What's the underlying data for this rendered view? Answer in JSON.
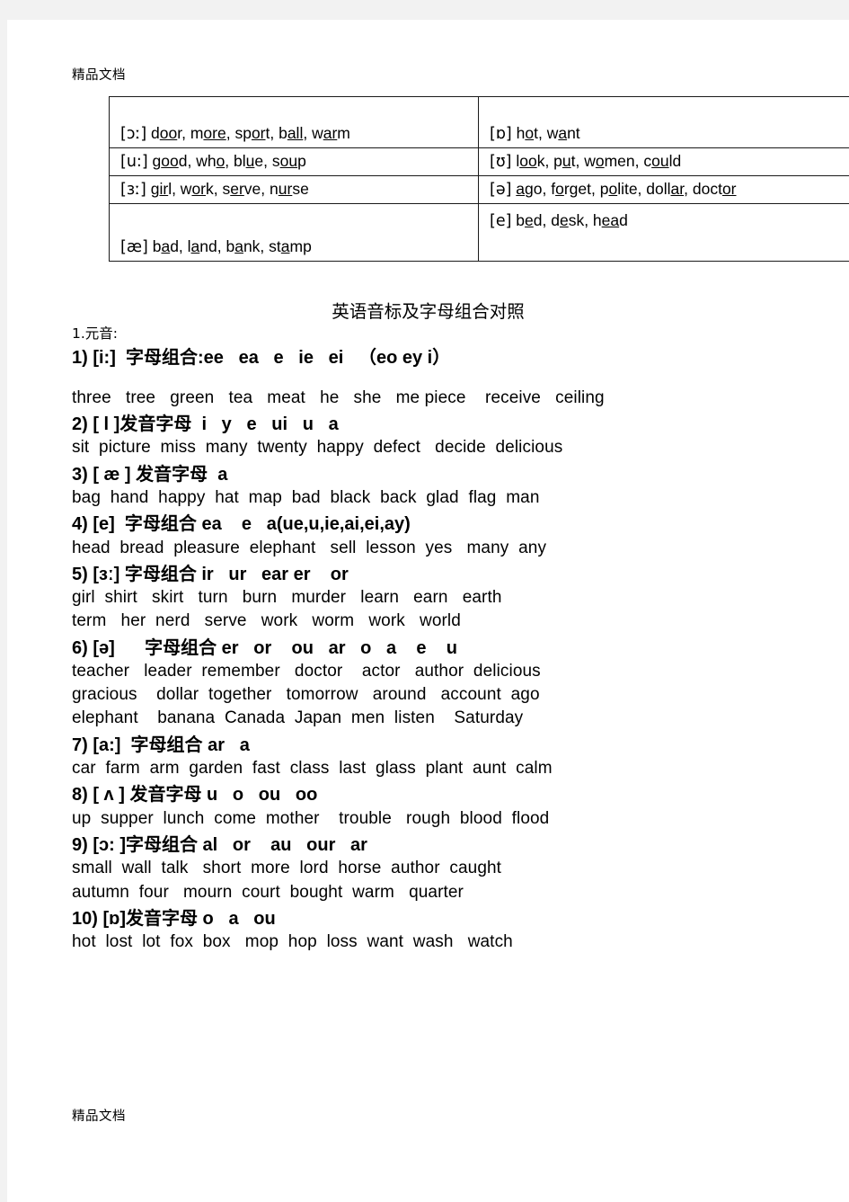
{
  "page": {
    "header_watermark": "精品文档",
    "footer_watermark": "精品文档",
    "title": "英语音标及字母组合对照",
    "section_heading": "1.元音:"
  },
  "table": {
    "rows": [
      {
        "left": {
          "symbol": "[ɔː]",
          "examples": "door, more, sport, ball, warm"
        },
        "right": {
          "symbol": "[ɒ]",
          "examples": "hot, want"
        }
      },
      {
        "left": {
          "symbol": "[u:]",
          "examples": "good, who, blue, soup"
        },
        "right": {
          "symbol": "[ʊ]",
          "examples": "look, put, women, could"
        }
      },
      {
        "left": {
          "symbol": "[ɜː]",
          "examples": "girl, work, serve, nurse"
        },
        "right": {
          "symbol": "[ə]",
          "examples": "ago, forget, polite, dollar, doctor"
        }
      },
      {
        "left": {
          "symbol": "[æ]",
          "examples": "bad, land, bank, stamp"
        },
        "right": {
          "symbol": "[e]",
          "examples": "bed, desk, head"
        }
      }
    ]
  },
  "vowel_rules": [
    {
      "number": "1)",
      "phoneme": "[i:]",
      "label": "字母组合:",
      "letters": "ee   ea   e   ie   ei   （eo ey i）",
      "heading_text": "1) [i:]  字母组合:ee   ea   e   ie   ei   （eo ey i）",
      "words": "three   tree   green   tea   meat   he   she   me piece    receive   ceiling"
    },
    {
      "number": "2)",
      "phoneme": "[ l ]",
      "label": "发音字母",
      "letters": "i   y   e   ui   u   a",
      "heading_text": "2) [ l ]发音字母  i   y   e   ui   u   a",
      "words": "sit  picture  miss  many  twenty  happy  defect   decide  delicious"
    },
    {
      "number": "3)",
      "phoneme": "[ æ ]",
      "label": "发音字母",
      "letters": "a",
      "heading_text": "3) [ æ ] 发音字母  a",
      "words": "bag  hand  happy  hat  map  bad  black  back  glad  flag  man"
    },
    {
      "number": "4)",
      "phoneme": "[e]",
      "label": "字母组合",
      "letters": "ea    e   a(ue,u,ie,ai,ei,ay)",
      "heading_text": "4) [e]  字母组合 ea    e   a(ue,u,ie,ai,ei,ay)",
      "words": "head  bread  pleasure  elephant   sell  lesson  yes   many  any"
    },
    {
      "number": "5)",
      "phoneme": "[ɜː]",
      "label": "字母组合",
      "letters": "ir   ur   ear er    or",
      "heading_text": "5) [ɜː] 字母组合 ir   ur   ear er    or",
      "words": "girl  shirt   skirt   turn   burn   murder   learn   earn   earth\nterm   her  nerd   serve   work   worm   work   world"
    },
    {
      "number": "6)",
      "phoneme": "[ə]",
      "label": "字母组合",
      "letters": "er   or    ou   ar   o   a    e    u",
      "heading_text": "6) [ə]      字母组合 er   or    ou   ar   o   a    e    u",
      "words": "teacher   leader  remember   doctor    actor   author  delicious\ngracious    dollar  together   tomorrow   around   account  ago\nelephant    banana  Canada  Japan  men  listen    Saturday"
    },
    {
      "number": "7)",
      "phoneme": "[a:]",
      "label": "字母组合",
      "letters": "ar   a",
      "heading_text": "7) [a:]  字母组合 ar   a",
      "words": "car  farm  arm  garden  fast  class  last  glass  plant  aunt  calm"
    },
    {
      "number": "8)",
      "phoneme": "[ ʌ ]",
      "label": "发音字母",
      "letters": "u   o   ou   oo",
      "heading_text": "8) [ ʌ ] 发音字母 u   o   ou   oo",
      "words": "up  supper  lunch  come  mother    trouble   rough  blood  flood"
    },
    {
      "number": "9)",
      "phoneme": "[ɔ: ]",
      "label": "字母组合",
      "letters": "al   or    au   our   ar",
      "heading_text": "9) [ɔ: ]字母组合 al   or    au   our   ar",
      "words": "small  wall  talk   short  more  lord  horse  author  caught\nautumn  four   mourn  court  bought  warm   quarter"
    },
    {
      "number": "10)",
      "phoneme": "[ɒ]",
      "label": "发音字母",
      "letters": "o   a   ou",
      "heading_text": "10) [ɒ]发音字母 o   a   ou",
      "words": "hot  lost  lot  fox  box   mop  hop  loss  want  wash   watch"
    }
  ]
}
